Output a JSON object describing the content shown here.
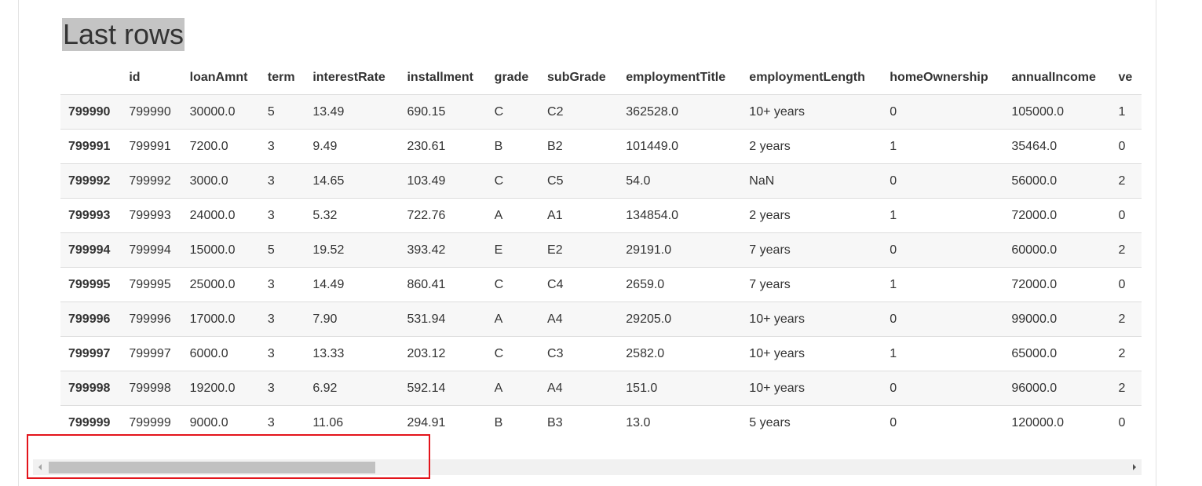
{
  "title": "Last rows",
  "table": {
    "columns": [
      "",
      "id",
      "loanAmnt",
      "term",
      "interestRate",
      "installment",
      "grade",
      "subGrade",
      "employmentTitle",
      "employmentLength",
      "homeOwnership",
      "annualIncome",
      "ve"
    ],
    "rows": [
      [
        "799990",
        "799990",
        "30000.0",
        "5",
        "13.49",
        "690.15",
        "C",
        "C2",
        "362528.0",
        "10+ years",
        "0",
        "105000.0",
        "1"
      ],
      [
        "799991",
        "799991",
        "7200.0",
        "3",
        "9.49",
        "230.61",
        "B",
        "B2",
        "101449.0",
        "2 years",
        "1",
        "35464.0",
        "0"
      ],
      [
        "799992",
        "799992",
        "3000.0",
        "3",
        "14.65",
        "103.49",
        "C",
        "C5",
        "54.0",
        "NaN",
        "0",
        "56000.0",
        "2"
      ],
      [
        "799993",
        "799993",
        "24000.0",
        "3",
        "5.32",
        "722.76",
        "A",
        "A1",
        "134854.0",
        "2 years",
        "1",
        "72000.0",
        "0"
      ],
      [
        "799994",
        "799994",
        "15000.0",
        "5",
        "19.52",
        "393.42",
        "E",
        "E2",
        "29191.0",
        "7 years",
        "0",
        "60000.0",
        "2"
      ],
      [
        "799995",
        "799995",
        "25000.0",
        "3",
        "14.49",
        "860.41",
        "C",
        "C4",
        "2659.0",
        "7 years",
        "1",
        "72000.0",
        "0"
      ],
      [
        "799996",
        "799996",
        "17000.0",
        "3",
        "7.90",
        "531.94",
        "A",
        "A4",
        "29205.0",
        "10+ years",
        "0",
        "99000.0",
        "2"
      ],
      [
        "799997",
        "799997",
        "6000.0",
        "3",
        "13.33",
        "203.12",
        "C",
        "C3",
        "2582.0",
        "10+ years",
        "1",
        "65000.0",
        "2"
      ],
      [
        "799998",
        "799998",
        "19200.0",
        "3",
        "6.92",
        "592.14",
        "A",
        "A4",
        "151.0",
        "10+ years",
        "0",
        "96000.0",
        "2"
      ],
      [
        "799999",
        "799999",
        "9000.0",
        "3",
        "11.06",
        "294.91",
        "B",
        "B3",
        "13.0",
        "5 years",
        "0",
        "120000.0",
        "0"
      ]
    ]
  },
  "scrollbar": {
    "orientation": "horizontal",
    "left_arrow_icon": "triangle-left-icon",
    "right_arrow_icon": "triangle-right-icon",
    "scroll_position": 0,
    "visible_fraction": 0.3
  },
  "colors": {
    "title_highlight": "#c4c4c4",
    "annotation_box": "#e3141b",
    "stripe": "#f7f7f7"
  }
}
